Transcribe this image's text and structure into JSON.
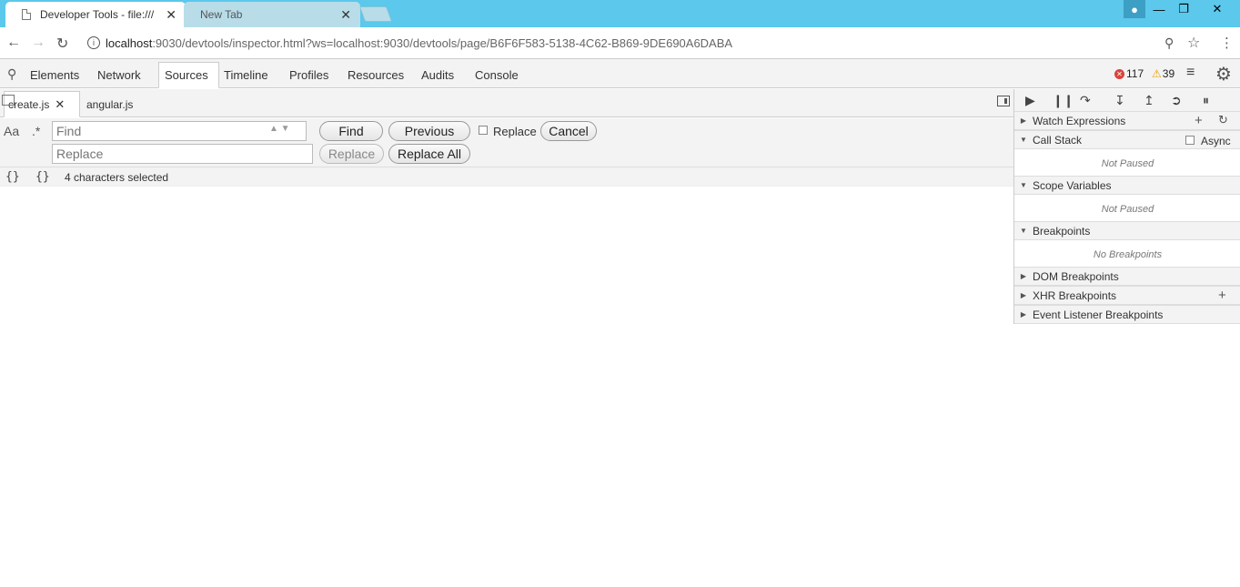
{
  "browser": {
    "tabs": [
      {
        "title": "Developer Tools - file:///",
        "close": "✕"
      },
      {
        "title": "New Tab",
        "close": "✕"
      }
    ],
    "address": {
      "info": "i",
      "host": "localhost",
      "path": ":9030/devtools/inspector.html?ws=localhost:9030/devtools/page/B6F6F583-5138-4C62-B869-9DE690A6DABA"
    }
  },
  "devtools": {
    "panels": [
      "Elements",
      "Network",
      "Sources",
      "Timeline",
      "Profiles",
      "Resources",
      "Audits",
      "Console"
    ],
    "selected_panel": "Sources",
    "errors": "117",
    "warnings": "39",
    "files": [
      {
        "name": "create.js",
        "close": "✕"
      },
      {
        "name": "angular.js"
      }
    ],
    "find": {
      "case_label": "Aa",
      "regex_label": ".*",
      "find_placeholder": "Find",
      "replace_placeholder": "Replace",
      "find_button": "Find",
      "previous_button": "Previous",
      "replace_checkbox_label": "Replace",
      "cancel_button": "Cancel",
      "replace_button": "Replace",
      "replace_all_button": "Replace All"
    },
    "status": {
      "pretty1": "{}",
      "pretty2": "{}",
      "selection": "4 characters selected"
    },
    "sidebar": {
      "watch": {
        "title": "Watch Expressions"
      },
      "callstack": {
        "title": "Call Stack",
        "async_label": "Async",
        "body": "Not Paused"
      },
      "scope": {
        "title": "Scope Variables",
        "body": "Not Paused"
      },
      "breakpoints": {
        "title": "Breakpoints",
        "body": "No Breakpoints"
      },
      "dom_breakpoints": {
        "title": "DOM Breakpoints"
      },
      "xhr_breakpoints": {
        "title": "XHR Breakpoints"
      },
      "event_breakpoints": {
        "title": "Event Listener Breakpoints"
      }
    }
  }
}
